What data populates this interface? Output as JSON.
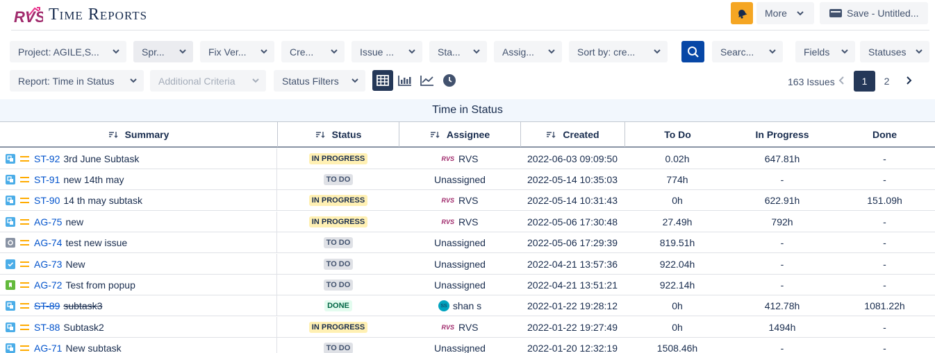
{
  "header": {
    "title": "Time Reports",
    "more_label": "More",
    "save_label": "Save - Untitled...",
    "accent": "#f5a623"
  },
  "filters": {
    "row1": [
      {
        "label": "Project: AGILE,S...",
        "name": "project-filter"
      },
      {
        "label": "Spr...",
        "name": "sprint-filter"
      },
      {
        "label": "Fix Ver...",
        "name": "fix-version-filter"
      },
      {
        "label": "Cre...",
        "name": "created-filter"
      },
      {
        "label": "Issue ...",
        "name": "issue-type-filter"
      },
      {
        "label": "Sta...",
        "name": "status-filter"
      },
      {
        "label": "Assig...",
        "name": "assignee-filter"
      },
      {
        "label": "Sort by: cre...",
        "name": "sort-by-filter"
      },
      {
        "label": "Searc...",
        "name": "search-filter"
      },
      {
        "label": "Fields",
        "name": "fields-filter"
      },
      {
        "label": "Statuses",
        "name": "statuses-filter"
      }
    ],
    "row2": [
      {
        "label": "Report: Time in Status",
        "name": "report-selector"
      },
      {
        "label": "Additional Criteria",
        "name": "additional-criteria"
      },
      {
        "label": "Status Filters",
        "name": "status-filters"
      }
    ]
  },
  "pagination": {
    "issues_count": "163 Issues",
    "pages": [
      "1",
      "2"
    ]
  },
  "table": {
    "title": "Time in Status",
    "columns": [
      "Summary",
      "Status",
      "Assignee",
      "Created",
      "To Do",
      "In Progress",
      "Done"
    ],
    "rows": [
      {
        "key": "ST-92",
        "summary": "3rd June Subtask",
        "status": "IN PROGRESS",
        "assignee": "RVS",
        "created": "2022-06-03 09:09:50",
        "todo": "0.02h",
        "progress": "647.81h",
        "done": "-"
      },
      {
        "key": "ST-91",
        "summary": "new 14th may",
        "status": "TO DO",
        "assignee": "Unassigned",
        "created": "2022-05-14 10:35:03",
        "todo": "774h",
        "progress": "-",
        "done": "-"
      },
      {
        "key": "ST-90",
        "summary": "14 th may subtask",
        "status": "IN PROGRESS",
        "assignee": "RVS",
        "created": "2022-05-14 10:31:43",
        "todo": "0h",
        "progress": "622.91h",
        "done": "151.09h"
      },
      {
        "key": "AG-75",
        "summary": "new",
        "status": "IN PROGRESS",
        "assignee": "RVS",
        "created": "2022-05-06 17:30:48",
        "todo": "27.49h",
        "progress": "792h",
        "done": "-"
      },
      {
        "key": "AG-74",
        "summary": "test new issue",
        "status": "TO DO",
        "assignee": "Unassigned",
        "created": "2022-05-06 17:29:39",
        "todo": "819.51h",
        "progress": "-",
        "done": "-"
      },
      {
        "key": "AG-73",
        "summary": "New",
        "status": "TO DO",
        "assignee": "Unassigned",
        "created": "2022-04-21 13:57:36",
        "todo": "922.04h",
        "progress": "-",
        "done": "-"
      },
      {
        "key": "AG-72",
        "summary": "Test from popup",
        "status": "TO DO",
        "assignee": "Unassigned",
        "created": "2022-04-21 13:51:21",
        "todo": "922.14h",
        "progress": "-",
        "done": "-"
      },
      {
        "key": "ST-89",
        "summary": "subtask3",
        "status": "DONE",
        "assignee": "shan s",
        "created": "2022-01-22 19:28:12",
        "todo": "0h",
        "progress": "412.78h",
        "done": "1081.22h"
      },
      {
        "key": "ST-88",
        "summary": "Subtask2",
        "status": "IN PROGRESS",
        "assignee": "RVS",
        "created": "2022-01-22 19:27:49",
        "todo": "0h",
        "progress": "1494h",
        "done": "-"
      },
      {
        "key": "AG-71",
        "summary": "New subtask",
        "status": "TO DO",
        "assignee": "Unassigned",
        "created": "2022-01-20 12:32:19",
        "todo": "1508.46h",
        "progress": "-",
        "done": "-"
      }
    ]
  }
}
